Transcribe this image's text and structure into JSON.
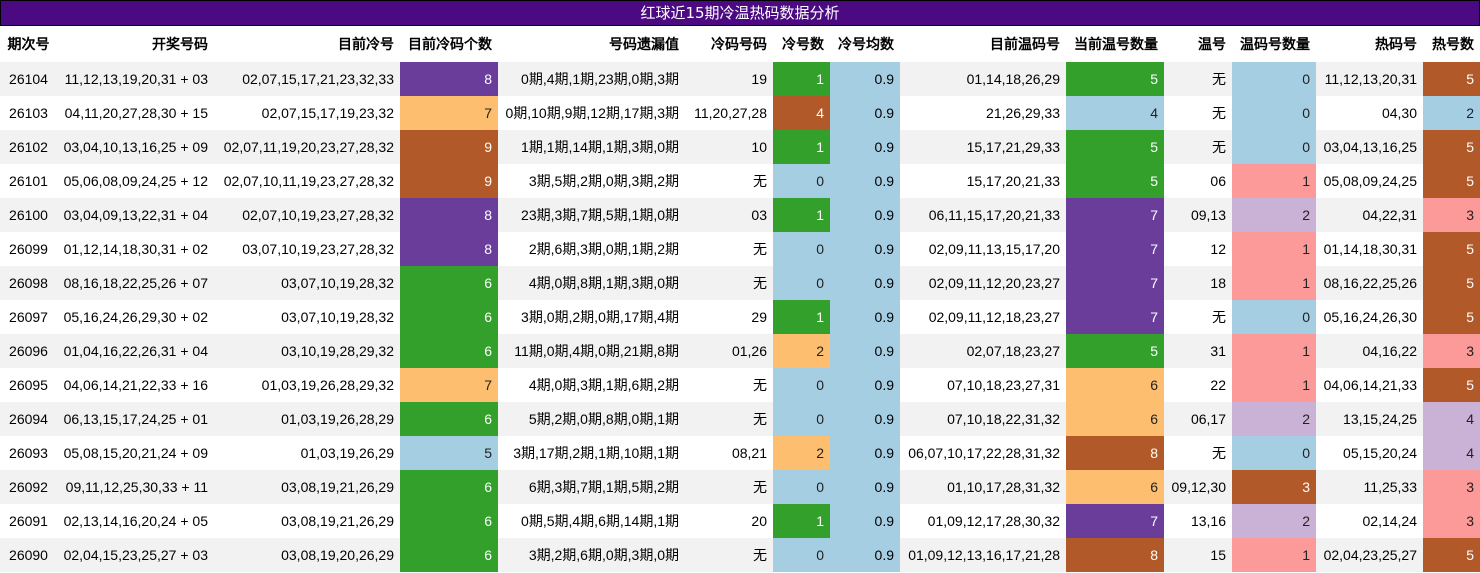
{
  "title": "红球近15期冷温热码数据分析",
  "headers": [
    "期次号",
    "开奖号码",
    "目前冷号",
    "目前冷码个数",
    "号码遗漏值",
    "冷码号码",
    "冷号数",
    "冷号均数",
    "目前温码号",
    "当前温号数量",
    "温号",
    "温码号数量",
    "热码号",
    "热号数"
  ],
  "colors": {
    "title_bg": "#4b0a82",
    "0": "#a6cee3",
    "1": "#fb9a99",
    "2": "#cab2d6",
    "3": "#fb9a99",
    "4": "#cab2d6",
    "5": "#b15928",
    "6": "#fdbf6f",
    "7": "#6a3d9a",
    "8": "#b15928",
    "9": "#b15928",
    "cold1": "#33a02c",
    "cold2": "#fdbf6f",
    "cold4": "#b15928",
    "coldcnt5": "#a6cee3",
    "coldcnt6": "#33a02c",
    "coldcnt7": "#fdbf6f",
    "coldcnt8": "#6a3d9a",
    "coldcnt9": "#b15928",
    "warm4": "#a6cee3",
    "warm5": "#33a02c",
    "warm6": "#fdbf6f",
    "warm7": "#6a3d9a",
    "warm8": "#b15928",
    "wn0": "#a6cee3",
    "wn1": "#fb9a99",
    "wn2": "#cab2d6",
    "wn3": "#b15928",
    "hot2": "#a6cee3",
    "hot3": "#fb9a99",
    "hot4": "#cab2d6",
    "hot5": "#b15928"
  },
  "rows": [
    [
      "26104",
      "11,12,13,19,20,31 + 03",
      "02,07,15,17,21,23,32,33",
      "8",
      "0期,4期,1期,23期,0期,3期",
      "19",
      "1",
      "0.9",
      "01,14,18,26,29",
      "5",
      "无",
      "0",
      "11,12,13,20,31",
      "5"
    ],
    [
      "26103",
      "04,11,20,27,28,30 + 15",
      "02,07,15,17,19,23,32",
      "7",
      "0期,10期,9期,12期,17期,3期",
      "11,20,27,28",
      "4",
      "0.9",
      "21,26,29,33",
      "4",
      "无",
      "0",
      "04,30",
      "2"
    ],
    [
      "26102",
      "03,04,10,13,16,25 + 09",
      "02,07,11,19,20,23,27,28,32",
      "9",
      "1期,1期,14期,1期,3期,0期",
      "10",
      "1",
      "0.9",
      "15,17,21,29,33",
      "5",
      "无",
      "0",
      "03,04,13,16,25",
      "5"
    ],
    [
      "26101",
      "05,06,08,09,24,25 + 12",
      "02,07,10,11,19,23,27,28,32",
      "9",
      "3期,5期,2期,0期,3期,2期",
      "无",
      "0",
      "0.9",
      "15,17,20,21,33",
      "5",
      "06",
      "1",
      "05,08,09,24,25",
      "5"
    ],
    [
      "26100",
      "03,04,09,13,22,31 + 04",
      "02,07,10,19,23,27,28,32",
      "8",
      "23期,3期,7期,5期,1期,0期",
      "03",
      "1",
      "0.9",
      "06,11,15,17,20,21,33",
      "7",
      "09,13",
      "2",
      "04,22,31",
      "3"
    ],
    [
      "26099",
      "01,12,14,18,30,31 + 02",
      "03,07,10,19,23,27,28,32",
      "8",
      "2期,6期,3期,0期,1期,2期",
      "无",
      "0",
      "0.9",
      "02,09,11,13,15,17,20",
      "7",
      "12",
      "1",
      "01,14,18,30,31",
      "5"
    ],
    [
      "26098",
      "08,16,18,22,25,26 + 07",
      "03,07,10,19,28,32",
      "6",
      "4期,0期,8期,1期,3期,0期",
      "无",
      "0",
      "0.9",
      "02,09,11,12,20,23,27",
      "7",
      "18",
      "1",
      "08,16,22,25,26",
      "5"
    ],
    [
      "26097",
      "05,16,24,26,29,30 + 02",
      "03,07,10,19,28,32",
      "6",
      "3期,0期,2期,0期,17期,4期",
      "29",
      "1",
      "0.9",
      "02,09,11,12,18,23,27",
      "7",
      "无",
      "0",
      "05,16,24,26,30",
      "5"
    ],
    [
      "26096",
      "01,04,16,22,26,31 + 04",
      "03,10,19,28,29,32",
      "6",
      "11期,0期,4期,0期,21期,8期",
      "01,26",
      "2",
      "0.9",
      "02,07,18,23,27",
      "5",
      "31",
      "1",
      "04,16,22",
      "3"
    ],
    [
      "26095",
      "04,06,14,21,22,33 + 16",
      "01,03,19,26,28,29,32",
      "7",
      "4期,0期,3期,1期,6期,2期",
      "无",
      "0",
      "0.9",
      "07,10,18,23,27,31",
      "6",
      "22",
      "1",
      "04,06,14,21,33",
      "5"
    ],
    [
      "26094",
      "06,13,15,17,24,25 + 01",
      "01,03,19,26,28,29",
      "6",
      "5期,2期,0期,8期,0期,1期",
      "无",
      "0",
      "0.9",
      "07,10,18,22,31,32",
      "6",
      "06,17",
      "2",
      "13,15,24,25",
      "4"
    ],
    [
      "26093",
      "05,08,15,20,21,24 + 09",
      "01,03,19,26,29",
      "5",
      "3期,17期,2期,1期,10期,1期",
      "08,21",
      "2",
      "0.9",
      "06,07,10,17,22,28,31,32",
      "8",
      "无",
      "0",
      "05,15,20,24",
      "4"
    ],
    [
      "26092",
      "09,11,12,25,30,33 + 11",
      "03,08,19,21,26,29",
      "6",
      "6期,3期,7期,1期,5期,2期",
      "无",
      "0",
      "0.9",
      "01,10,17,28,31,32",
      "6",
      "09,12,30",
      "3",
      "11,25,33",
      "3"
    ],
    [
      "26091",
      "02,13,14,16,20,24 + 05",
      "03,08,19,21,26,29",
      "6",
      "0期,5期,4期,6期,14期,1期",
      "20",
      "1",
      "0.9",
      "01,09,12,17,28,30,32",
      "7",
      "13,16",
      "2",
      "02,14,24",
      "3"
    ],
    [
      "26090",
      "02,04,15,23,25,27 + 03",
      "03,08,19,20,26,29",
      "6",
      "3期,2期,6期,0期,3期,0期",
      "无",
      "0",
      "0.9",
      "01,09,12,13,16,17,21,28",
      "8",
      "15",
      "1",
      "02,04,23,25,27",
      "5"
    ]
  ]
}
